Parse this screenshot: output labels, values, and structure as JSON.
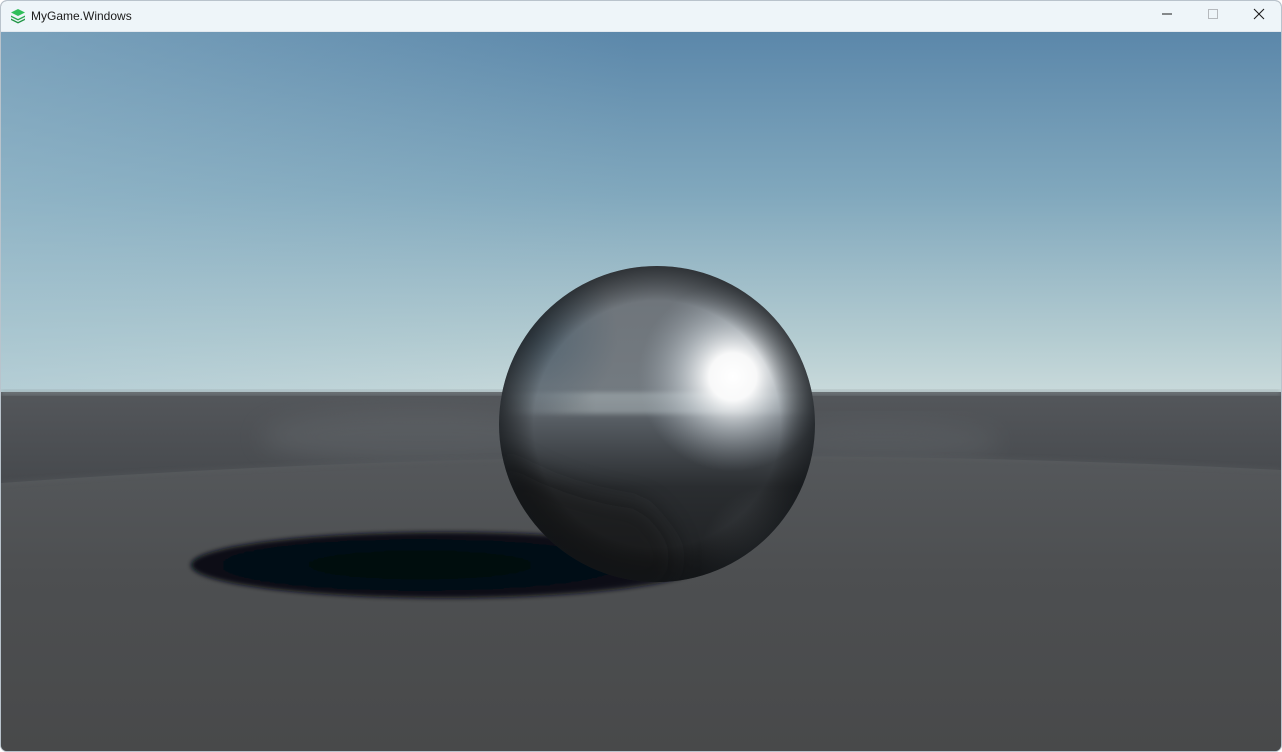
{
  "window": {
    "title": "MyGame.Windows",
    "app_icon": "layers-stack-icon",
    "controls": {
      "minimize": "minimize-icon",
      "maximize": "maximize-icon",
      "close": "close-icon"
    }
  },
  "scene": {
    "sky_top_color": "#5b87aa",
    "sky_horizon_color": "#c6d9dc",
    "ground_color": "#4a4b4d",
    "far_ground_color": "#45484c",
    "sphere_color": "#5e656c",
    "shadow_color": "#050a12",
    "icon_color": "#2fbf5a"
  }
}
